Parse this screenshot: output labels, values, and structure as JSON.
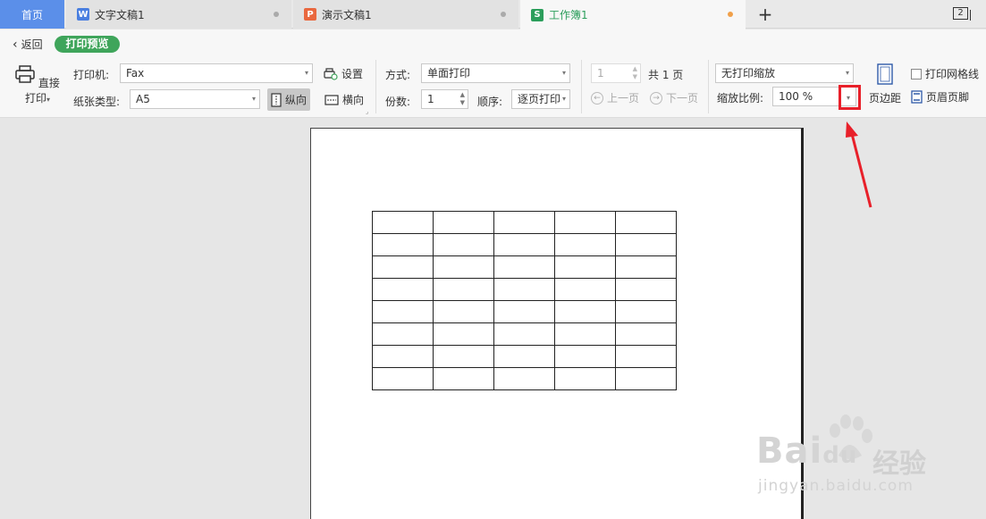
{
  "tabs": {
    "home": "首页",
    "doc": "文字文稿1",
    "ppt": "演示文稿1",
    "xls": "工作簿1",
    "doc_icon": "W",
    "ppt_icon": "P",
    "xls_icon": "S",
    "new_tab": "+",
    "window_count": "2"
  },
  "header": {
    "back": "返回",
    "mode": "打印预览"
  },
  "printer": {
    "direct_print": "直接打印",
    "printer_label": "打印机:",
    "printer_value": "Fax",
    "settings": "设置",
    "paper_label": "纸张类型:",
    "paper_value": "A5",
    "portrait": "纵向",
    "landscape": "横向"
  },
  "print_options": {
    "method_label": "方式:",
    "method_value": "单面打印",
    "copies_label": "份数:",
    "copies_value": "1",
    "order_label": "顺序:",
    "order_value": "逐页打印"
  },
  "pagination": {
    "page_value": "1",
    "total": "共 1 页",
    "prev": "上一页",
    "next": "下一页"
  },
  "scaling": {
    "mode_value": "无打印缩放",
    "ratio_label": "缩放比例:",
    "ratio_value": "100 %"
  },
  "right_tools": {
    "margins": "页边距",
    "gridlines": "打印网格线",
    "header_footer": "页眉页脚"
  },
  "sheet": {
    "rows": 8,
    "cols": 5
  },
  "watermark": {
    "brand": "Bai",
    "brand_tail": "du",
    "cn": "经验",
    "url": "jingyan.baidu.com"
  },
  "colors": {
    "accent_green": "#3fa55b",
    "home_tab": "#5b8fe9",
    "highlight_red": "#e8202a"
  }
}
